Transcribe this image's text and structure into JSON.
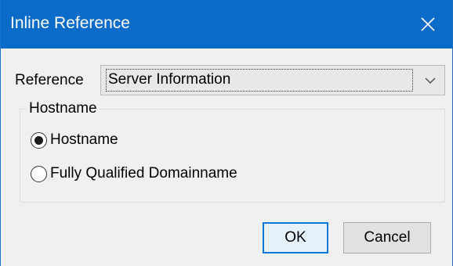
{
  "window": {
    "title": "Inline Reference",
    "close_icon": "close-icon"
  },
  "reference": {
    "label": "Reference",
    "selected": "Server Information",
    "arrow_icon": "chevron-down-icon"
  },
  "hostname_group": {
    "legend": "Hostname",
    "options": [
      {
        "label": "Hostname",
        "checked": true
      },
      {
        "label": "Fully Qualified Domainname",
        "checked": false
      }
    ]
  },
  "buttons": {
    "ok": "OK",
    "cancel": "Cancel"
  },
  "colors": {
    "titlebar": "#0a6bc9",
    "dialog_bg": "#f0f0f0",
    "default_button_border": "#0a78d7"
  }
}
